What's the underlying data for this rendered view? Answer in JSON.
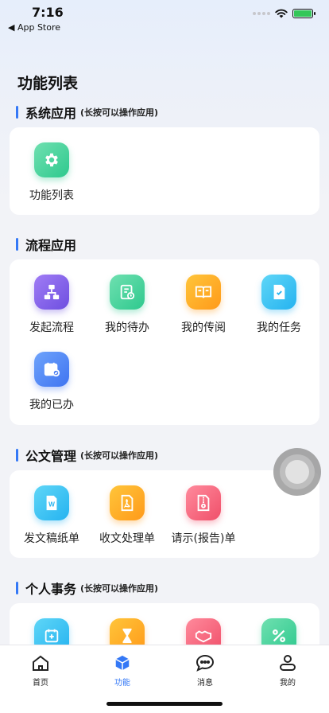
{
  "status_bar": {
    "time": "7:16",
    "back_app": "◀ App Store"
  },
  "page_title": "功能列表",
  "sections": {
    "system": {
      "title": "系统应用",
      "subtitle": "(长按可以操作应用)",
      "items": [
        {
          "label": "功能列表",
          "icon": "gear-icon",
          "color": "green"
        }
      ]
    },
    "process": {
      "title": "流程应用",
      "items": [
        {
          "label": "发起流程",
          "icon": "flowchart-icon",
          "color": "purple"
        },
        {
          "label": "我的待办",
          "icon": "todo-document-icon",
          "color": "green"
        },
        {
          "label": "我的传阅",
          "icon": "open-book-icon",
          "color": "orange"
        },
        {
          "label": "我的任务",
          "icon": "task-check-icon",
          "color": "cyan"
        },
        {
          "label": "我的已办",
          "icon": "calendar-check-icon",
          "color": "blue"
        }
      ]
    },
    "documents": {
      "title": "公文管理",
      "subtitle": "(长按可以操作应用)",
      "items": [
        {
          "label": "发文稿纸单",
          "icon": "word-document-icon",
          "color": "cyan"
        },
        {
          "label": "收文处理单",
          "icon": "pdf-document-icon",
          "color": "orange"
        },
        {
          "label": "请示(报告)单",
          "icon": "zip-document-icon",
          "color": "red"
        }
      ]
    },
    "personal": {
      "title": "个人事务",
      "subtitle": "(长按可以操作应用)",
      "items": [
        {
          "icon": "calendar-add-icon",
          "color": "cyan"
        },
        {
          "icon": "hourglass-icon",
          "color": "orange"
        },
        {
          "icon": "handshake-icon",
          "color": "red"
        },
        {
          "icon": "percent-icon",
          "color": "green"
        }
      ]
    }
  },
  "tab_bar": {
    "tabs": [
      {
        "label": "首页",
        "icon": "home-icon",
        "active": false
      },
      {
        "label": "功能",
        "icon": "cube-icon",
        "active": true
      },
      {
        "label": "消息",
        "icon": "chat-bubble-icon",
        "active": false
      },
      {
        "label": "我的",
        "icon": "user-icon",
        "active": false
      }
    ]
  },
  "colors": {
    "accent": "#3478f6",
    "background": "#f2f3f7",
    "card": "#ffffff"
  }
}
